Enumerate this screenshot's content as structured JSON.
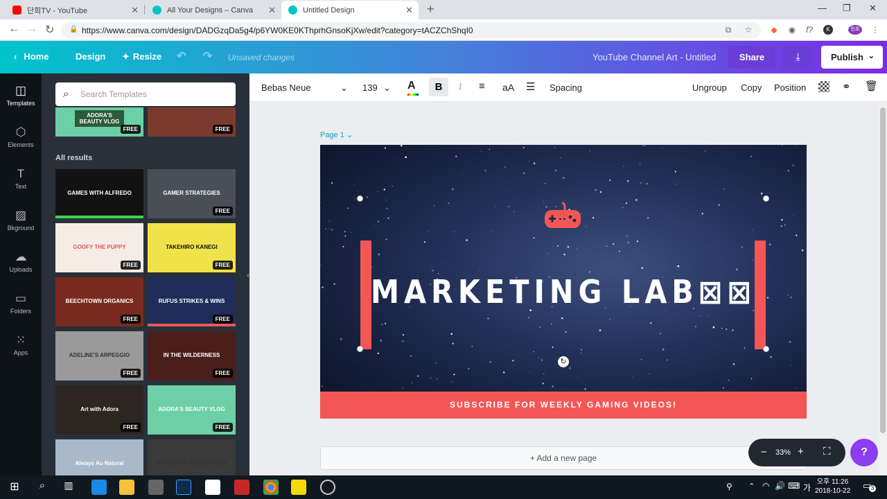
{
  "browser": {
    "tabs": [
      {
        "title": "단희TV - YouTube",
        "icon": "youtube-icon",
        "color": "#ff0000"
      },
      {
        "title": "All Your Designs – Canva",
        "icon": "canva-icon",
        "color": "#00c4cc"
      },
      {
        "title": "Untitled Design",
        "icon": "canva-icon",
        "color": "#00c4cc",
        "active": true
      }
    ],
    "url": "https://www.canva.com/design/DADGzqDa5g4/p6YW0KE0KThprhGnsoKjXw/edit?category=tACZChShqI0",
    "profile_badge": "민호"
  },
  "header": {
    "home": "Home",
    "design": "Design",
    "resize": "Resize",
    "unsaved": "Unsaved changes",
    "title": "YouTube Channel Art - Untitled",
    "share": "Share",
    "publish": "Publish"
  },
  "sidebar": [
    {
      "label": "Templates",
      "icon": "templates-icon",
      "active": true
    },
    {
      "label": "Elements",
      "icon": "elements-icon"
    },
    {
      "label": "Text",
      "icon": "text-icon"
    },
    {
      "label": "Bkground",
      "icon": "background-icon"
    },
    {
      "label": "Uploads",
      "icon": "uploads-icon"
    },
    {
      "label": "Folders",
      "icon": "folders-icon"
    },
    {
      "label": "Apps",
      "icon": "apps-icon"
    }
  ],
  "panel": {
    "search_placeholder": "Search Templates",
    "all_results": "All results",
    "free_badge": "FREE",
    "top_thumbs": [
      {
        "text": "ADORA'S BEAUTY VLOG",
        "bg": "#6ccfa6",
        "free": true
      },
      {
        "text": "",
        "bg": "#7a3b2e",
        "free": true
      }
    ],
    "templates": [
      {
        "text": "GAMES WITH ALFREDO",
        "bg": "#121212",
        "fg": "#ffffff",
        "accent": "#39d353",
        "free": false
      },
      {
        "text": "GAMER STRATEGIES",
        "bg": "#4a4f57",
        "fg": "#ffffff",
        "free": true
      },
      {
        "text": "GOOFY THE PUPPY",
        "bg": "#f5ece6",
        "fg": "#e05a4f",
        "free": true
      },
      {
        "text": "TAKEHIRO KANEGI",
        "bg": "#f0e24a",
        "fg": "#111111",
        "free": true
      },
      {
        "text": "BEECHTOWN ORGANICS",
        "bg": "#7a2a1e",
        "fg": "#ffffff",
        "free": true
      },
      {
        "text": "RUFUS STRIKES & WINS",
        "bg": "#1f2d5a",
        "fg": "#ffffff",
        "accent": "#f25755",
        "free": true
      },
      {
        "text": "ADELINE'S ARPEGGIO",
        "bg": "#9a9a9a",
        "fg": "#333333",
        "free": true
      },
      {
        "text": "IN THE WILDERNESS",
        "bg": "#4a1e1a",
        "fg": "#ffffff",
        "free": true
      },
      {
        "text": "Art with Adora",
        "bg": "#2b2620",
        "fg": "#ffffff",
        "free": true
      },
      {
        "text": "ADORA'S BEAUTY VLOG",
        "bg": "#6ccfa6",
        "fg": "#ffffff",
        "free": true
      },
      {
        "text": "Always Au Natural",
        "bg": "#a9b9c9",
        "fg": "#ffffff",
        "free": false
      },
      {
        "text": "A GAMER'S ADVENTURES",
        "bg": "#3a3a3a",
        "fg": "#333333",
        "free": false
      }
    ]
  },
  "toolbar": {
    "font": "Bebas Neue",
    "size": "139",
    "case": "aA",
    "spacing": "Spacing",
    "ungroup": "Ungroup",
    "copy": "Copy",
    "position": "Position"
  },
  "canvas": {
    "page_label": "Page 1",
    "headline": "MARKETING LAB⊠⊠",
    "subscribe": "SUBSCRIBE FOR WEEKLY GAMING VIDEOS!",
    "accent": "#f25755",
    "add_page": "+ Add a new page",
    "zoom": "33%"
  },
  "taskbar": {
    "time": "오후 11:26",
    "date": "2018-10-22",
    "ime": "가",
    "notifications": "3"
  }
}
